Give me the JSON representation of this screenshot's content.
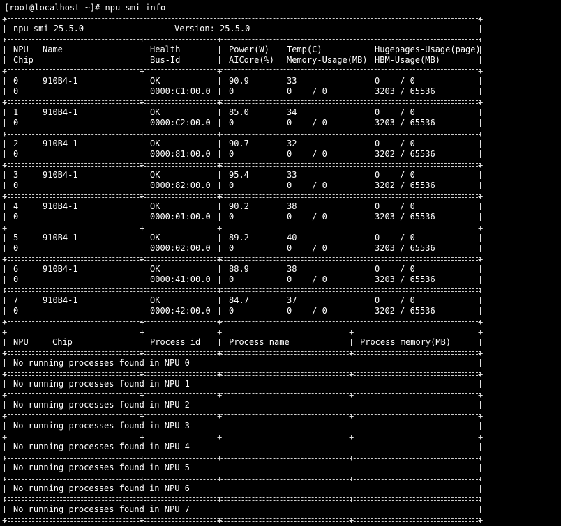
{
  "prompt_line": "[root@localhost ~]# npu-smi info",
  "banner": {
    "tool": "npu-smi 25.5.0",
    "version": "Version: 25.5.0"
  },
  "npu_headers": {
    "row1": [
      "NPU",
      "Name",
      "Health",
      "Power(W)",
      "Temp(C)",
      "Hugepages-Usage(page)"
    ],
    "row2": [
      "Chip",
      "Bus-Id",
      "AICore(%)",
      "Memory-Usage(MB)",
      "HBM-Usage(MB)"
    ]
  },
  "npus": [
    {
      "npu": "0",
      "name": "910B4-1",
      "health": "OK",
      "power": "90.9",
      "temp": "33",
      "hugepages": "0    / 0",
      "chip": "0",
      "bus_id": "0000:C1:00.0",
      "aicore": "0",
      "memory": "0    / 0",
      "hbm": "3203 / 65536"
    },
    {
      "npu": "1",
      "name": "910B4-1",
      "health": "OK",
      "power": "85.0",
      "temp": "34",
      "hugepages": "0    / 0",
      "chip": "0",
      "bus_id": "0000:C2:00.0",
      "aicore": "0",
      "memory": "0    / 0",
      "hbm": "3203 / 65536"
    },
    {
      "npu": "2",
      "name": "910B4-1",
      "health": "OK",
      "power": "90.7",
      "temp": "32",
      "hugepages": "0    / 0",
      "chip": "0",
      "bus_id": "0000:81:00.0",
      "aicore": "0",
      "memory": "0    / 0",
      "hbm": "3202 / 65536"
    },
    {
      "npu": "3",
      "name": "910B4-1",
      "health": "OK",
      "power": "95.4",
      "temp": "33",
      "hugepages": "0    / 0",
      "chip": "0",
      "bus_id": "0000:82:00.0",
      "aicore": "0",
      "memory": "0    / 0",
      "hbm": "3202 / 65536"
    },
    {
      "npu": "4",
      "name": "910B4-1",
      "health": "OK",
      "power": "90.2",
      "temp": "38",
      "hugepages": "0    / 0",
      "chip": "0",
      "bus_id": "0000:01:00.0",
      "aicore": "0",
      "memory": "0    / 0",
      "hbm": "3203 / 65536"
    },
    {
      "npu": "5",
      "name": "910B4-1",
      "health": "OK",
      "power": "89.2",
      "temp": "40",
      "hugepages": "0    / 0",
      "chip": "0",
      "bus_id": "0000:02:00.0",
      "aicore": "0",
      "memory": "0    / 0",
      "hbm": "3203 / 65536"
    },
    {
      "npu": "6",
      "name": "910B4-1",
      "health": "OK",
      "power": "88.9",
      "temp": "38",
      "hugepages": "0    / 0",
      "chip": "0",
      "bus_id": "0000:41:00.0",
      "aicore": "0",
      "memory": "0    / 0",
      "hbm": "3203 / 65536"
    },
    {
      "npu": "7",
      "name": "910B4-1",
      "health": "OK",
      "power": "84.7",
      "temp": "37",
      "hugepages": "0    / 0",
      "chip": "0",
      "bus_id": "0000:42:00.0",
      "aicore": "0",
      "memory": "0    / 0",
      "hbm": "3202 / 65536"
    }
  ],
  "process_headers": [
    "NPU",
    "Chip",
    "Process id",
    "Process name",
    "Process memory(MB)"
  ],
  "process_rows": [
    "No running processes found in NPU 0",
    "No running processes found in NPU 1",
    "No running processes found in NPU 2",
    "No running processes found in NPU 3",
    "No running processes found in NPU 4",
    "No running processes found in NPU 5",
    "No running processes found in NPU 6",
    "No running processes found in NPU 7"
  ]
}
